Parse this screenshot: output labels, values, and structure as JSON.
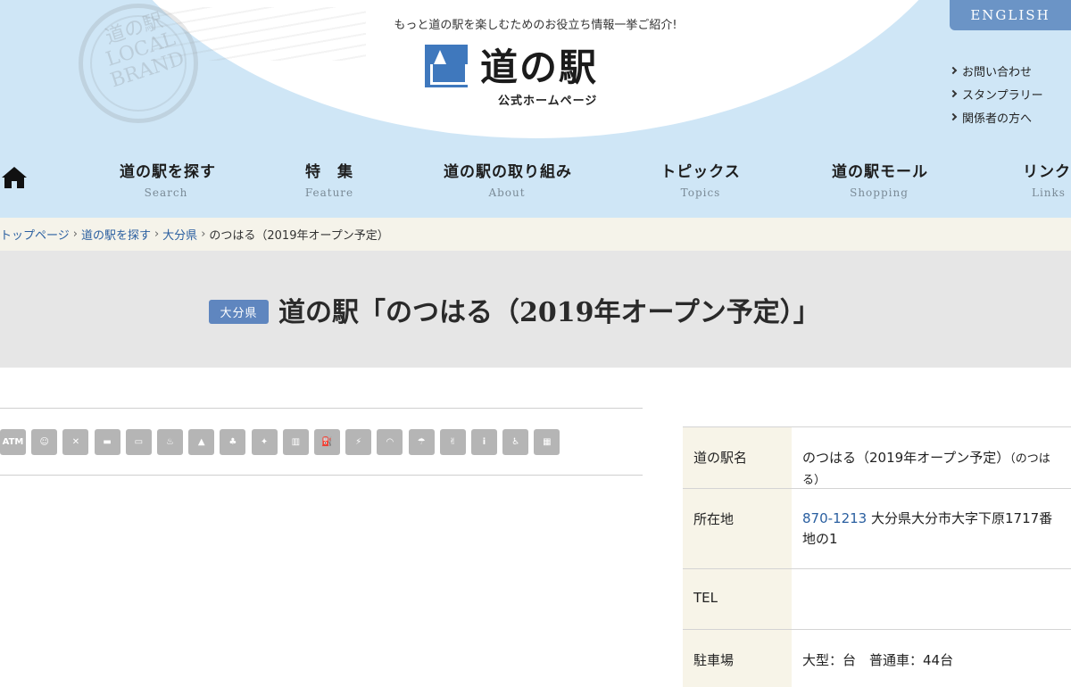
{
  "header": {
    "tagline": "もっと道の駅を楽しむためのお役立ち情報一挙ご紹介!",
    "logo_title": "道の駅",
    "logo_subtitle": "公式ホームページ",
    "stamp_text": "道の駅 LOCAL BRAND",
    "english_label": "ENGLISH",
    "side_links": [
      "お問い合わせ",
      "スタンプラリー",
      "関係者の方へ"
    ],
    "colors": {
      "sky": "#cfe6f6",
      "accent": "#6b94c6"
    }
  },
  "nav": {
    "items": [
      {
        "jp": "道の駅を探す",
        "en": "Search"
      },
      {
        "jp": "特　集",
        "en": "Feature"
      },
      {
        "jp": "道の駅の取り組み",
        "en": "About"
      },
      {
        "jp": "トピックス",
        "en": "Topics"
      },
      {
        "jp": "道の駅モール",
        "en": "Shopping"
      },
      {
        "jp": "リンク",
        "en": "Links"
      }
    ]
  },
  "breadcrumb": {
    "items": [
      "トップページ",
      "道の駅を探す",
      "大分県"
    ],
    "current": "のつはる（2019年オープン予定）"
  },
  "title": {
    "prefecture": "大分県",
    "text": "道の駅「のつはる（2019年オープン予定）」"
  },
  "facility_icons": [
    {
      "name": "atm-icon",
      "glyph": "ATM"
    },
    {
      "name": "baby-care-icon",
      "glyph": "☺"
    },
    {
      "name": "restaurant-icon",
      "glyph": "✕"
    },
    {
      "name": "cafe-icon",
      "glyph": "▬"
    },
    {
      "name": "lodging-icon",
      "glyph": "▭"
    },
    {
      "name": "hot-spring-icon",
      "glyph": "♨"
    },
    {
      "name": "camping-icon",
      "glyph": "▲"
    },
    {
      "name": "park-icon",
      "glyph": "♣"
    },
    {
      "name": "observatory-icon",
      "glyph": "✦"
    },
    {
      "name": "museum-icon",
      "glyph": "▥"
    },
    {
      "name": "gas-station-icon",
      "glyph": "⛽"
    },
    {
      "name": "ev-charger-icon",
      "glyph": "⚡"
    },
    {
      "name": "wifi-icon",
      "glyph": "◠"
    },
    {
      "name": "shower-icon",
      "glyph": "☂"
    },
    {
      "name": "experience-icon",
      "glyph": "✌"
    },
    {
      "name": "information-icon",
      "glyph": "i"
    },
    {
      "name": "accessible-icon",
      "glyph": "♿"
    },
    {
      "name": "shop-icon",
      "glyph": "▦"
    }
  ],
  "info": {
    "name_label": "道の駅名",
    "name_value": "のつはる（2019年オープン予定）",
    "name_reading": "（のつはる）",
    "address_label": "所在地",
    "zip": "870-1213",
    "address": "大分県大分市大字下原1717番地の1",
    "tel_label": "TEL",
    "tel_value": "",
    "parking_label": "駐車場",
    "parking_value": "大型：台　普通車：44台"
  }
}
